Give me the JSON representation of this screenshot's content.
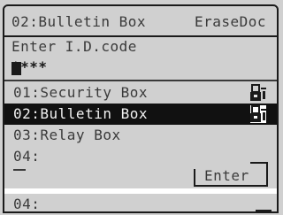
{
  "header": {
    "title": "02:Bulletin Box",
    "action": "EraseDoc"
  },
  "prompt": {
    "label": "Enter I.D.code",
    "value": "****"
  },
  "boxes": {
    "items": [
      {
        "label": "01:Security Box",
        "icon": "locked-box-icon",
        "selected": false
      },
      {
        "label": "02:Bulletin Box",
        "icon": "locked-box-icon",
        "selected": true
      },
      {
        "label": "03:Relay Box",
        "selected": false
      },
      {
        "label": "04:",
        "selected": false
      }
    ]
  },
  "softkey": {
    "enter_label": "Enter"
  },
  "lower": {
    "label": "04:"
  },
  "colors": {
    "lcd_background": "#e6e6e6",
    "text": "#3a3a3a",
    "highlight": "#111111",
    "highlight_text": "#f2f2f2"
  }
}
